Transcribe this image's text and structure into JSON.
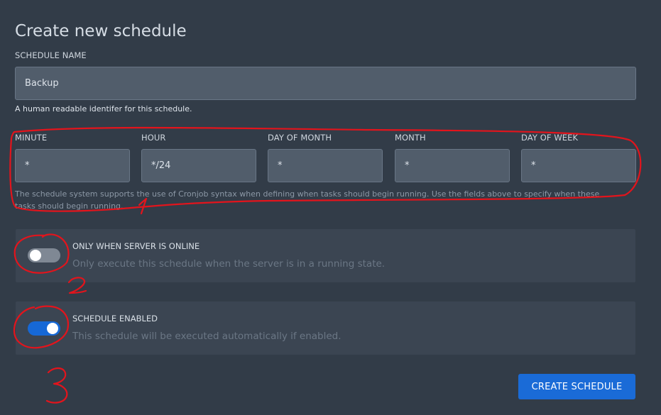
{
  "page": {
    "title": "Create new schedule"
  },
  "schedule_name": {
    "label": "SCHEDULE NAME",
    "value": "Backup",
    "help": "A human readable identifer for this schedule."
  },
  "cron": {
    "fields": [
      {
        "label": "MINUTE",
        "value": "*"
      },
      {
        "label": "HOUR",
        "value": "*/24"
      },
      {
        "label": "DAY OF MONTH",
        "value": "*"
      },
      {
        "label": "MONTH",
        "value": "*"
      },
      {
        "label": "DAY OF WEEK",
        "value": "*"
      }
    ],
    "help_line1": "The schedule system supports the use of Cronjob syntax when defining when tasks should begin running. Use the fields above to specify when these",
    "help_line2": "tasks should begin running."
  },
  "options": {
    "only_online": {
      "title": "ONLY WHEN SERVER IS ONLINE",
      "description": "Only execute this schedule when the server is in a running state.",
      "enabled": false
    },
    "enabled": {
      "title": "SCHEDULE ENABLED",
      "description": "This schedule will be executed automatically if enabled.",
      "enabled": true
    }
  },
  "actions": {
    "create_label": "CREATE SCHEDULE"
  },
  "annotations": {
    "color": "#e3141c",
    "labels": [
      "1",
      "2",
      "3"
    ]
  },
  "colors": {
    "background": "#323c48",
    "accent": "#1a6bd7",
    "input_bg": "#515d6b"
  }
}
